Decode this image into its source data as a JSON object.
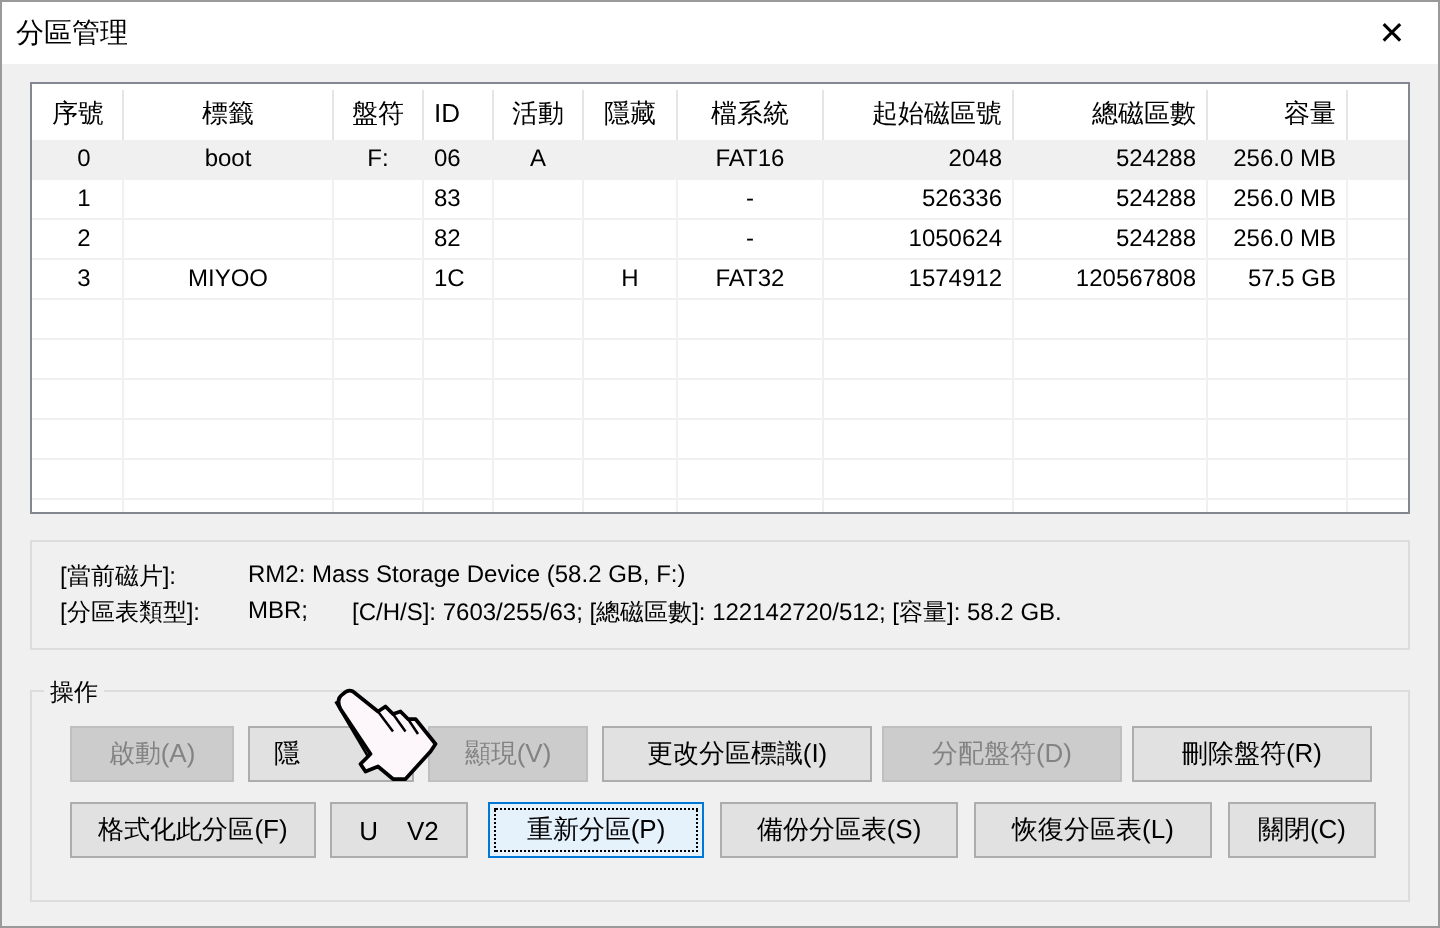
{
  "window": {
    "title": "分區管理",
    "close": "✕"
  },
  "table": {
    "columns": [
      "序號",
      "標籤",
      "盤符",
      "ID",
      "活動",
      "隱藏",
      "檔系統",
      "起始磁區號",
      "總磁區數",
      "容量"
    ],
    "rows": [
      {
        "selected": true,
        "cells": [
          "0",
          "boot",
          "F:",
          "06",
          "A",
          "",
          "FAT16",
          "2048",
          "524288",
          "256.0 MB"
        ]
      },
      {
        "selected": false,
        "cells": [
          "1",
          "",
          "",
          "83",
          "",
          "",
          "-",
          "526336",
          "524288",
          "256.0 MB"
        ]
      },
      {
        "selected": false,
        "cells": [
          "2",
          "",
          "",
          "82",
          "",
          "",
          "-",
          "1050624",
          "524288",
          "256.0 MB"
        ]
      },
      {
        "selected": false,
        "cells": [
          "3",
          "MIYOO",
          "",
          "1C",
          "",
          "H",
          "FAT32",
          "1574912",
          "120567808",
          "57.5 GB"
        ]
      }
    ]
  },
  "disk_info": {
    "lines": [
      {
        "label": "[當前磁片]:",
        "parts": [
          "RM2: Mass Storage Device (58.2 GB, F:)"
        ]
      },
      {
        "label": "[分區表類型]:",
        "parts": [
          "MBR;",
          "[C/H/S]: 7603/255/63; [總磁區數]: 122142720/512; [容量]: 58.2 GB."
        ]
      }
    ]
  },
  "operations": {
    "title": "操作",
    "rows": [
      [
        {
          "label": "啟動(A)",
          "disabled": true,
          "focused": false
        },
        {
          "label": "隱",
          "disabled": false,
          "focused": false
        },
        {
          "label": "顯現(V)",
          "disabled": true,
          "focused": false
        },
        {
          "label": "更改分區標識(I)",
          "disabled": false,
          "focused": false
        },
        {
          "label": "分配盤符(D)",
          "disabled": true,
          "focused": false
        },
        {
          "label": "刪除盤符(R)",
          "disabled": false,
          "focused": false
        }
      ],
      [
        {
          "label": "格式化此分區(F)",
          "disabled": false,
          "focused": false
        },
        {
          "label": "U    V2",
          "disabled": false,
          "focused": false
        },
        {
          "label": "重新分區(P)",
          "disabled": false,
          "focused": true
        },
        {
          "label": "備份分區表(S)",
          "disabled": false,
          "focused": false
        },
        {
          "label": "恢復分區表(L)",
          "disabled": false,
          "focused": false
        },
        {
          "label": "關閉(C)",
          "disabled": false,
          "focused": false
        }
      ]
    ]
  }
}
